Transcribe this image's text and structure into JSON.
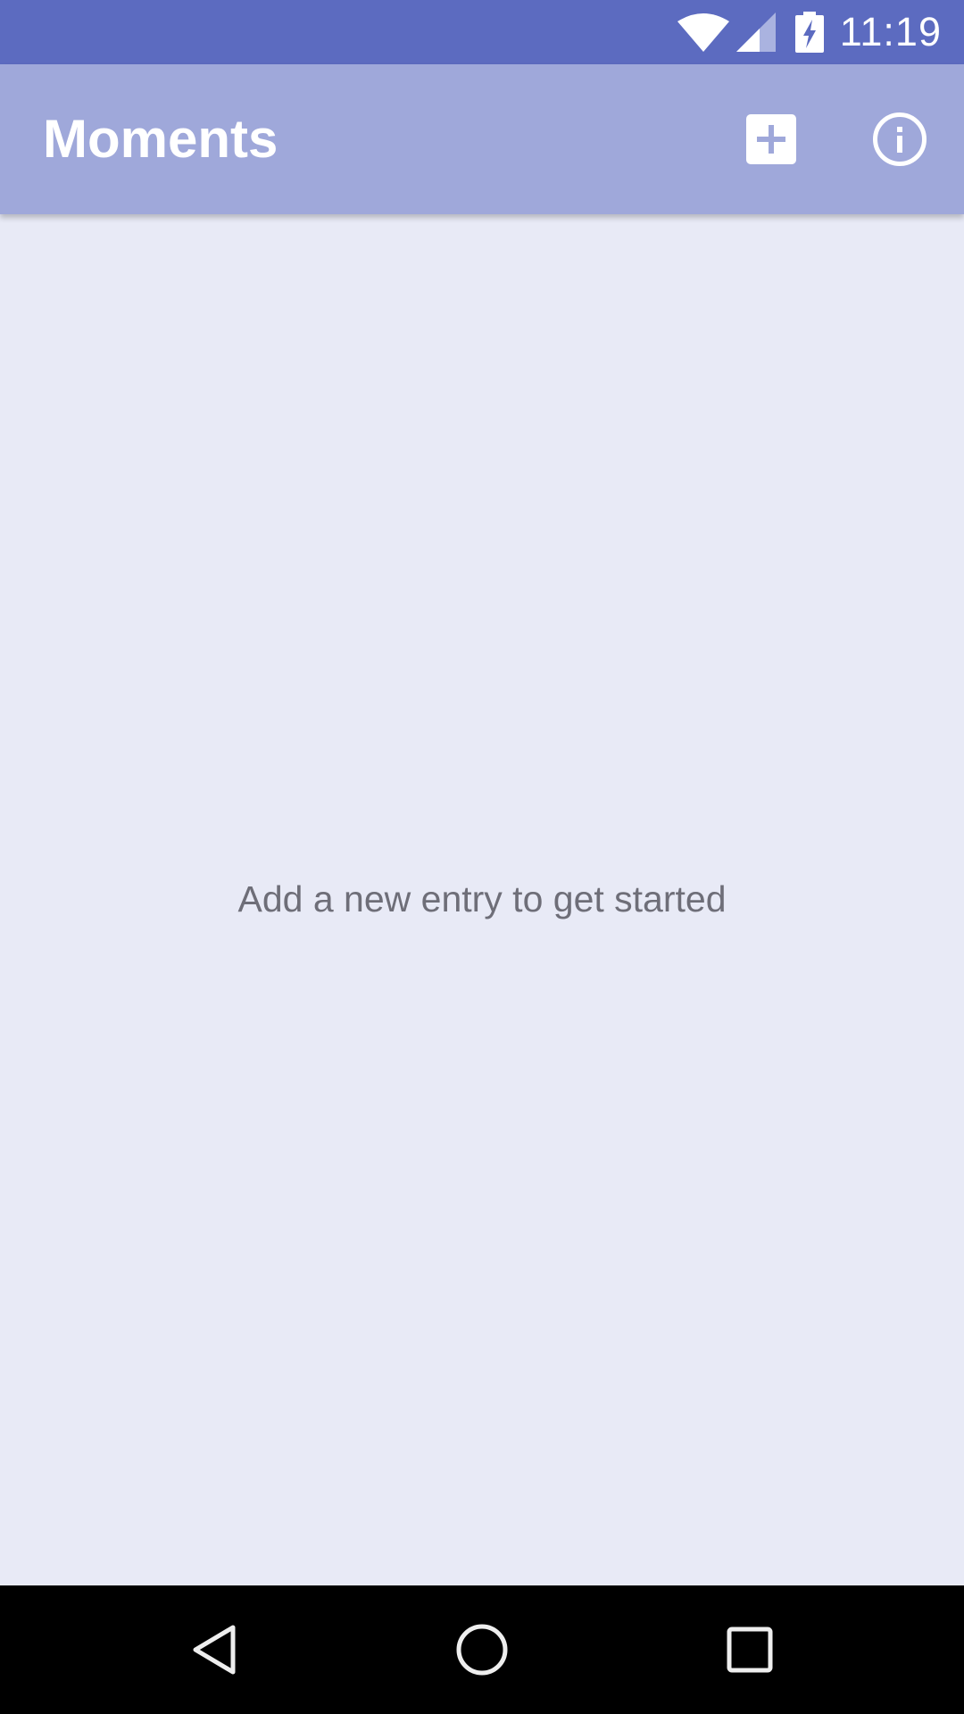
{
  "status_bar": {
    "time": "11:19",
    "icons": [
      "wifi-icon",
      "cell-signal-icon",
      "battery-charging-icon"
    ],
    "background": "#5c6bc0"
  },
  "app_bar": {
    "title": "Moments",
    "background": "#9fa8da",
    "actions": [
      "add-icon",
      "info-icon"
    ]
  },
  "main": {
    "empty_message": "Add a new entry to get started",
    "background": "#e8eaf6"
  },
  "nav_bar": {
    "buttons": [
      "back-icon",
      "home-icon",
      "recents-icon"
    ]
  }
}
